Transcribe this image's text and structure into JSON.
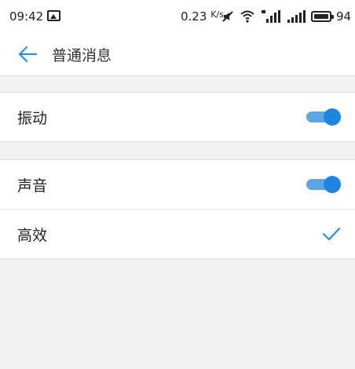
{
  "status_bar": {
    "time": "09:42",
    "speed_value": "0.23",
    "speed_unit": "K/s",
    "battery": "94",
    "icons": [
      "image-icon",
      "mute-icon",
      "wifi-icon",
      "4g-signal-icon",
      "signal-icon",
      "battery-icon"
    ]
  },
  "header": {
    "title": "普通消息",
    "back_icon": "back-arrow-icon"
  },
  "settings": {
    "vibration": {
      "label": "振动",
      "enabled": true
    },
    "sound": {
      "label": "声音",
      "enabled": true
    },
    "efficient": {
      "label": "高效",
      "checked": true
    }
  },
  "colors": {
    "accent": "#1e86e0",
    "accent_track": "#5aa7e3",
    "background": "#f2f2f2"
  }
}
